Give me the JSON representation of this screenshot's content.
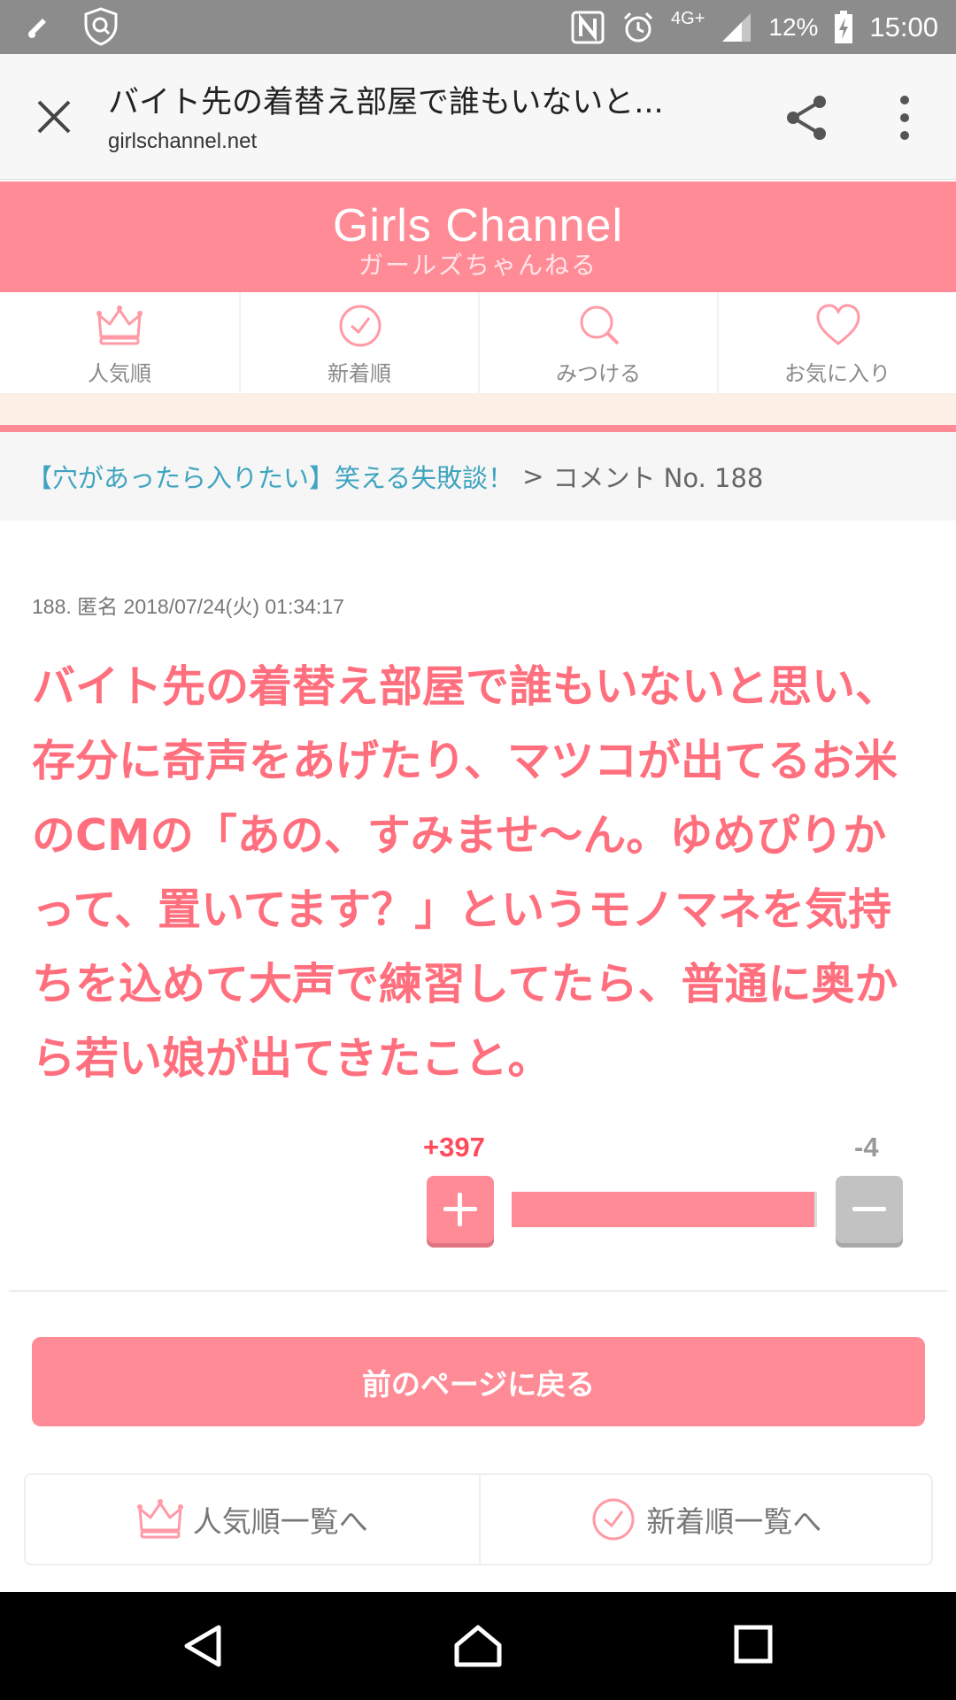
{
  "status_bar": {
    "network": "4G+",
    "battery": "12%",
    "time": "15:00"
  },
  "browser": {
    "page_title": "バイト先の着替え部屋で誰もいないと...",
    "url": "girlschannel.net"
  },
  "site": {
    "logo_en": "Girls Channel",
    "logo_ja": "ガールズちゃんねる",
    "brand_color": "#ff8b96"
  },
  "nav": [
    {
      "label": "人気順",
      "icon": "crown-icon"
    },
    {
      "label": "新着順",
      "icon": "clock-icon"
    },
    {
      "label": "みつける",
      "icon": "search-icon"
    },
    {
      "label": "お気に入り",
      "icon": "heart-icon"
    }
  ],
  "breadcrumb": {
    "topic": "【穴があったら入りたい】笑える失敗談！",
    "separator": ">",
    "current": "コメント No. 188"
  },
  "comment": {
    "meta": "188. 匿名 2018/07/24(火) 01:34:17",
    "text": "バイト先の着替え部屋で誰もいないと思い、存分に奇声をあげたり、マツコが出てるお米のCMの「あの、すみませ〜ん。ゆめぴりかって、置いてます？」というモノマネを気持ちを込めて大声で練習してたら、普通に奥から若い娘が出てきたこと。",
    "plus": "+397",
    "minus": "-4",
    "plus_share": 0.99
  },
  "actions": {
    "back": "前のページに戻る",
    "popular_list": "人気順一覧へ",
    "new_list": "新着順一覧へ"
  }
}
